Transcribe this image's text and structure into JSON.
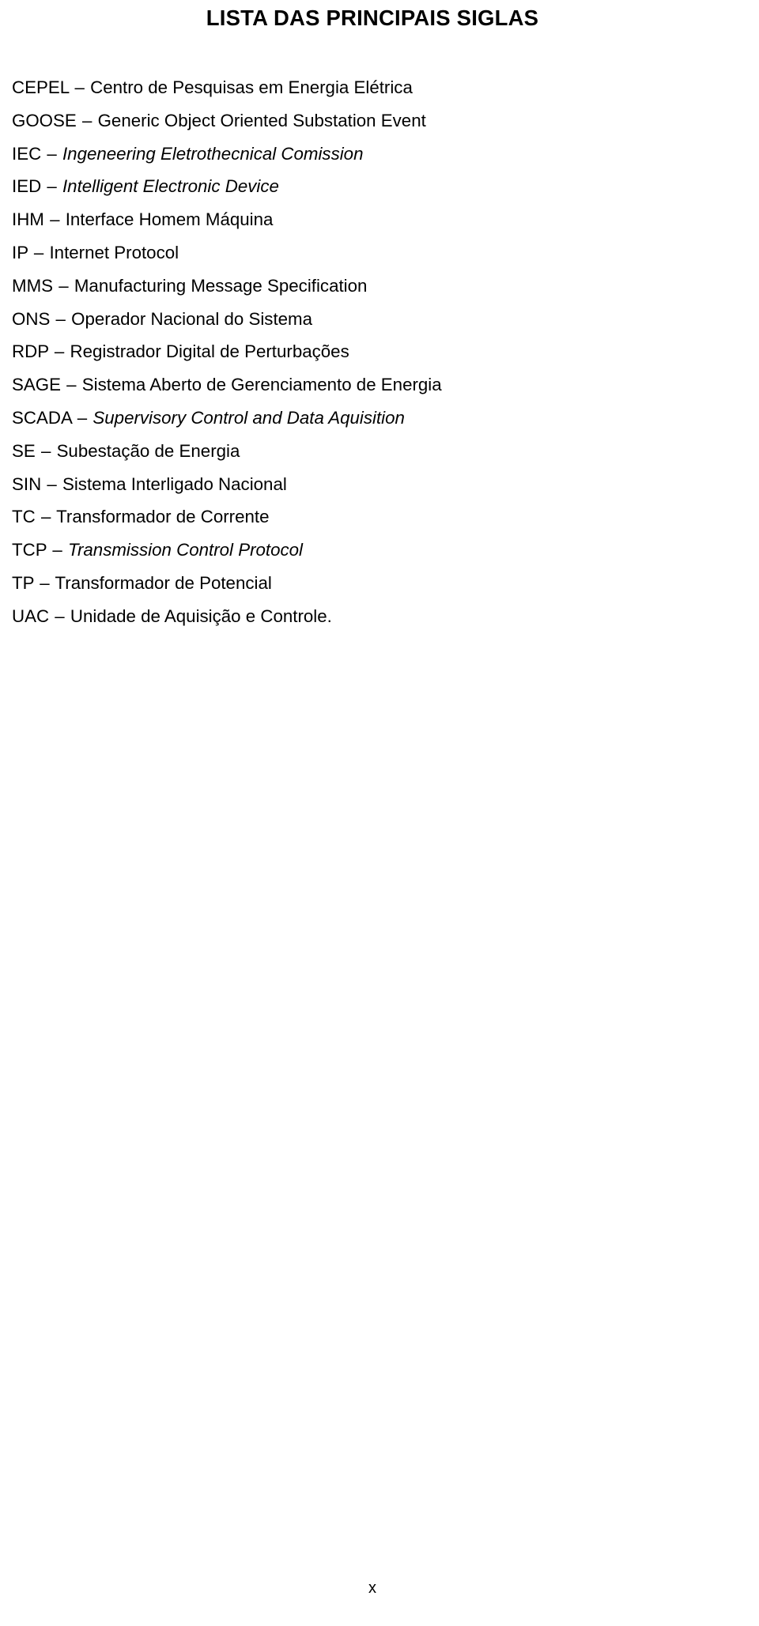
{
  "document": {
    "title": "LISTA DAS PRINCIPAIS SIGLAS",
    "separator": "–",
    "page_number": "x",
    "text_color": "#000000",
    "background_color": "#ffffff"
  },
  "siglas": [
    {
      "abbr": "CEPEL",
      "definition": "Centro de Pesquisas em Energia Elétrica",
      "italic": false
    },
    {
      "abbr": "GOOSE",
      "definition": "Generic Object Oriented Substation Event",
      "italic": false
    },
    {
      "abbr": "IEC",
      "definition": "Ingeneering Eletrothecnical Comission",
      "italic": true
    },
    {
      "abbr": "IED",
      "definition": "Intelligent Electronic Device",
      "italic": true
    },
    {
      "abbr": "IHM",
      "definition": "Interface Homem Máquina",
      "italic": false
    },
    {
      "abbr": "IP",
      "definition": "Internet Protocol",
      "italic": false
    },
    {
      "abbr": "MMS",
      "definition": "Manufacturing Message Specification",
      "italic": false
    },
    {
      "abbr": "ONS",
      "definition": "Operador Nacional do Sistema",
      "italic": false
    },
    {
      "abbr": "RDP",
      "definition": "Registrador Digital de Perturbações",
      "italic": false
    },
    {
      "abbr": "SAGE",
      "definition": "Sistema Aberto de Gerenciamento de Energia",
      "italic": false
    },
    {
      "abbr": "SCADA",
      "definition": "Supervisory Control and Data Aquisition",
      "italic": true
    },
    {
      "abbr": "SE",
      "definition": "Subestação de Energia",
      "italic": false
    },
    {
      "abbr": "SIN",
      "definition": "Sistema Interligado Nacional",
      "italic": false
    },
    {
      "abbr": "TC",
      "definition": "Transformador de Corrente",
      "italic": false
    },
    {
      "abbr": "TCP",
      "definition": "Transmission Control Protocol",
      "italic": true
    },
    {
      "abbr": "TP",
      "definition": "Transformador de Potencial",
      "italic": false
    },
    {
      "abbr": "UAC",
      "definition": "Unidade de Aquisição e Controle.",
      "italic": false
    }
  ]
}
